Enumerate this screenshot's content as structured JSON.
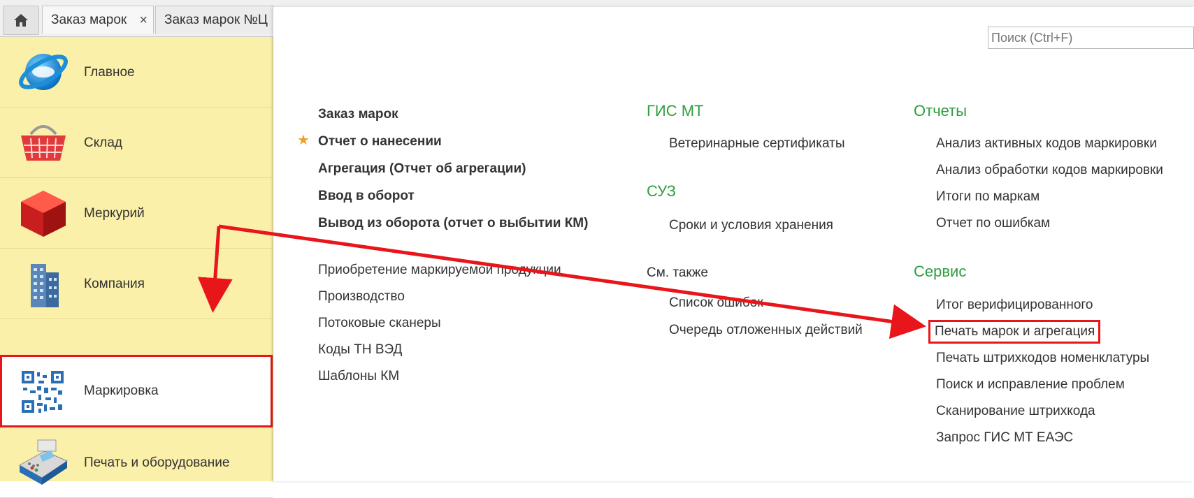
{
  "tabs": [
    {
      "label": "Заказ марок"
    },
    {
      "label": "Заказ марок №Ц"
    }
  ],
  "search": {
    "placeholder": "Поиск (Ctrl+F)"
  },
  "sidebar": {
    "items": [
      {
        "label": "Главное",
        "icon": "globe-icon"
      },
      {
        "label": "Склад",
        "icon": "basket-icon"
      },
      {
        "label": "Меркурий",
        "icon": "cube-icon"
      },
      {
        "label": "Компания",
        "icon": "building-icon"
      },
      {
        "label": "Маркировка",
        "icon": "qr-code-icon"
      },
      {
        "label": "Печать и оборудование",
        "icon": "pos-terminal-icon"
      }
    ]
  },
  "col1": {
    "bold_items": [
      "Заказ марок",
      "Отчет о нанесении",
      "Агрегация (Отчет об агрегации)",
      "Ввод в оборот",
      "Вывод из оборота (отчет о выбытии КМ)"
    ],
    "items": [
      "Приобретение маркируемой продукции",
      "Производство",
      "Потоковые сканеры",
      "Коды ТН ВЭД",
      "Шаблоны КМ"
    ]
  },
  "col2": {
    "gis_header": "ГИС МТ",
    "gis_items": [
      "Ветеринарные сертификаты"
    ],
    "suz_header": "СУЗ",
    "suz_items": [
      "Сроки и условия хранения"
    ],
    "see_also": "См. также",
    "see_items": [
      "Список ошибок",
      "Очередь отложенных действий"
    ]
  },
  "col3": {
    "reports_header": "Отчеты",
    "reports_items": [
      "Анализ активных кодов маркировки",
      "Анализ обработки кодов маркировки",
      "Итоги по маркам",
      "Отчет по ошибкам"
    ],
    "service_header": "Сервис",
    "service_items": [
      "Итог верифицированного",
      "Печать марок и агрегация",
      "Печать штрихкодов номенклатуры",
      "Поиск и исправление проблем",
      "Сканирование штрихкода",
      "Запрос ГИС МТ ЕАЭС"
    ]
  },
  "colors": {
    "accent_green": "#2e9e3e",
    "highlight_red": "#e8161a",
    "sidebar_bg": "#fbf0a9"
  }
}
